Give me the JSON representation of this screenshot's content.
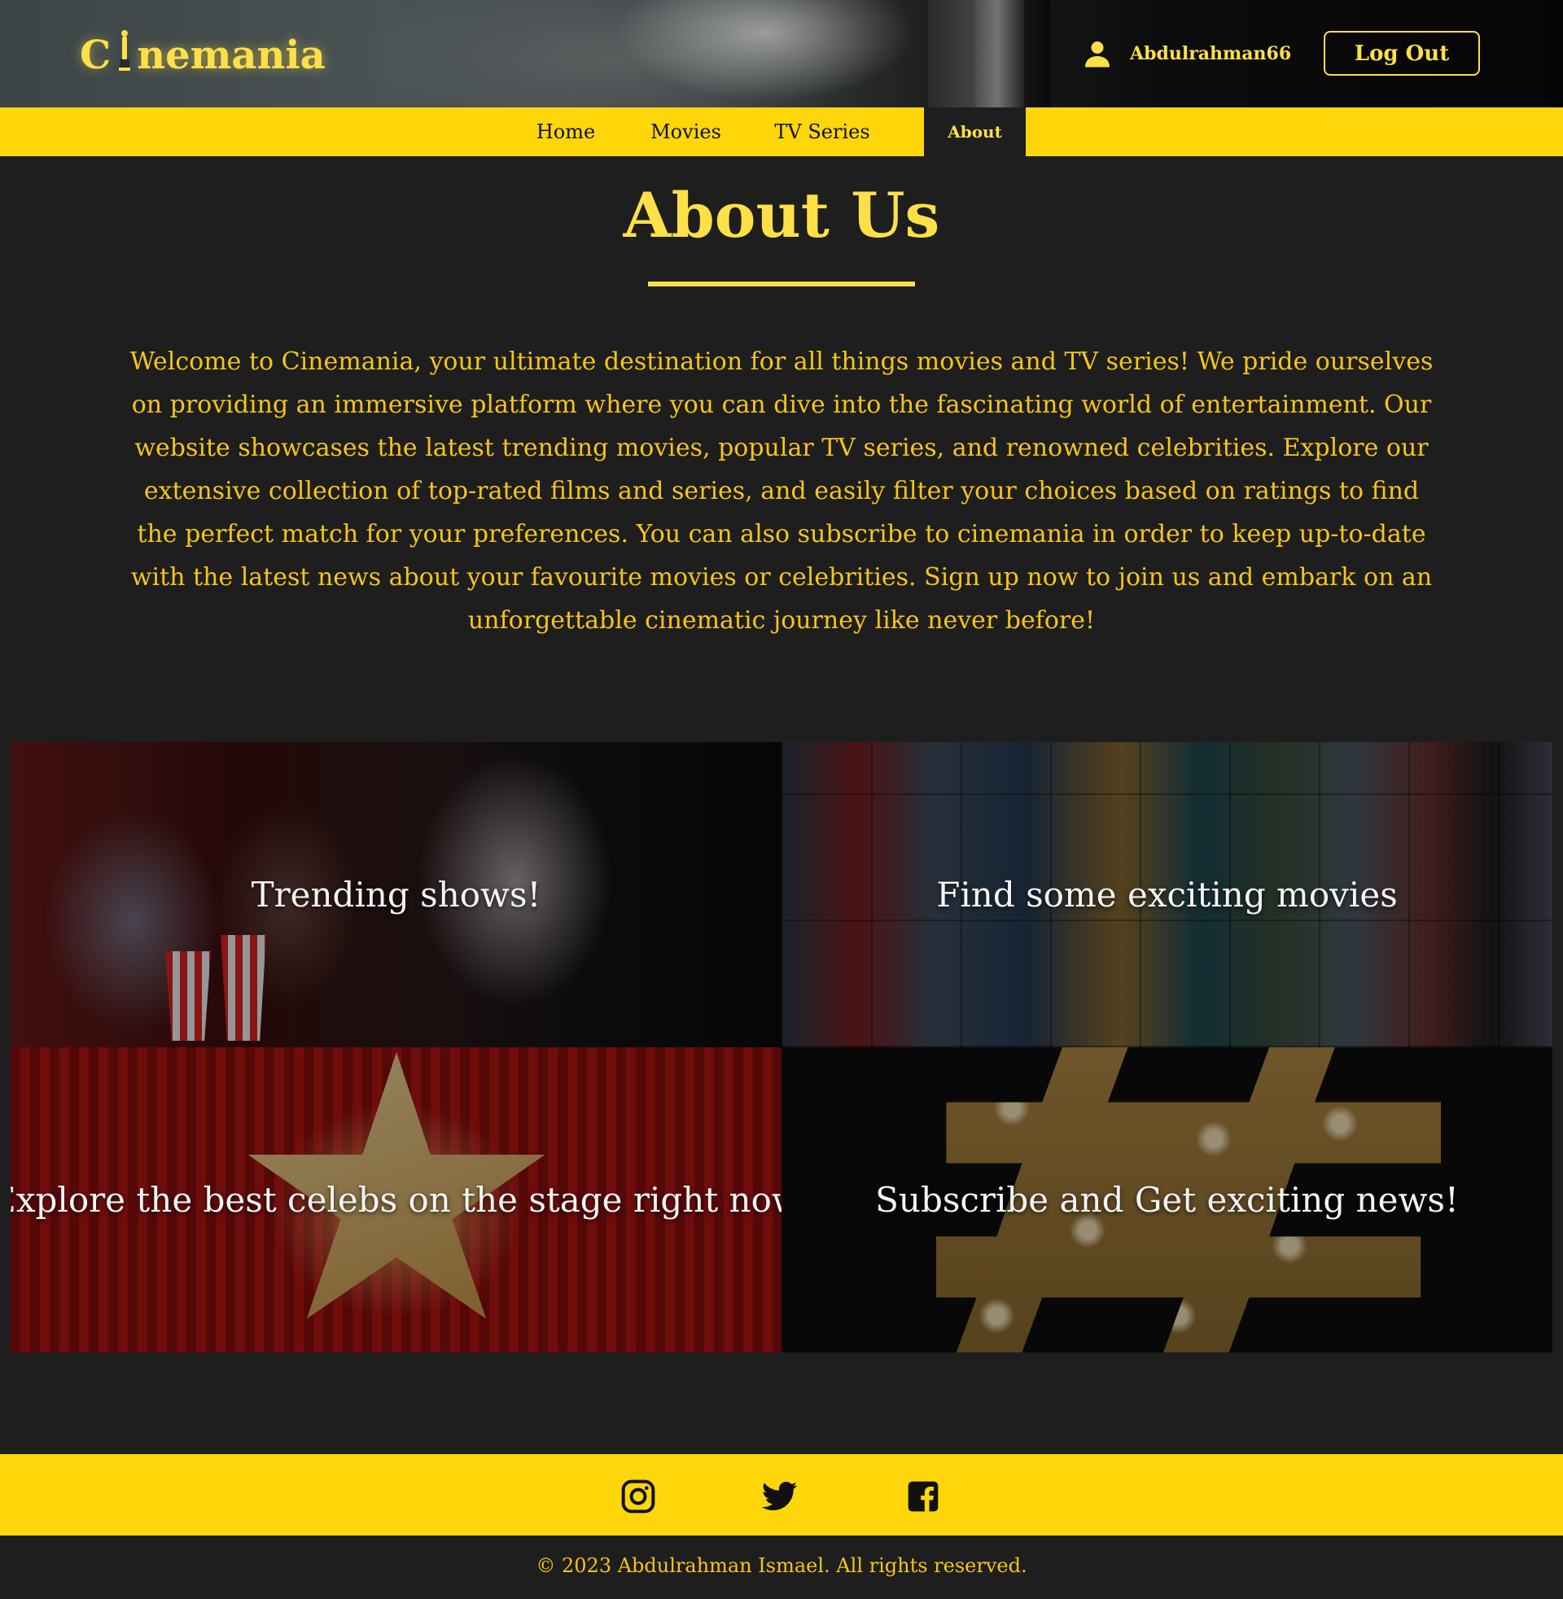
{
  "header": {
    "logo_left": "C",
    "logo_right": "nemania",
    "username": "Abdulrahman66",
    "logout_label": "Log Out"
  },
  "nav": {
    "items": [
      {
        "label": "Home"
      },
      {
        "label": "Movies"
      },
      {
        "label": "TV Series"
      },
      {
        "label": "About"
      }
    ],
    "active": "About"
  },
  "about": {
    "title": "About Us",
    "body": "Welcome to Cinemania, your ultimate destination for all things movies and TV series! We pride ourselves on providing an immersive platform where you can dive into the fascinating world of entertainment. Our website showcases the latest trending movies, popular TV series, and renowned celebrities. Explore our extensive collection of top-rated films and series, and easily filter your choices based on ratings to find the perfect match for your preferences. You can also subscribe to cinemania in order to keep up-to-date with the latest news about your favourite movies or celebrities. Sign up now to join us and embark on an unforgettable cinematic journey like never before!"
  },
  "tiles": [
    {
      "caption": "Trending shows!"
    },
    {
      "caption": "Find some exciting movies"
    },
    {
      "caption": "Explore the best celebs on the stage right now"
    },
    {
      "caption": "Subscribe and Get exciting news!"
    }
  ],
  "footer": {
    "social": [
      "instagram-icon",
      "twitter-icon",
      "facebook-icon"
    ],
    "copyright": "© 2023 Abdulrahman Ismael. All rights reserved."
  },
  "colors": {
    "accent": "#ffd60a",
    "accent_text": "#fde047",
    "background": "#1e1e1e"
  }
}
